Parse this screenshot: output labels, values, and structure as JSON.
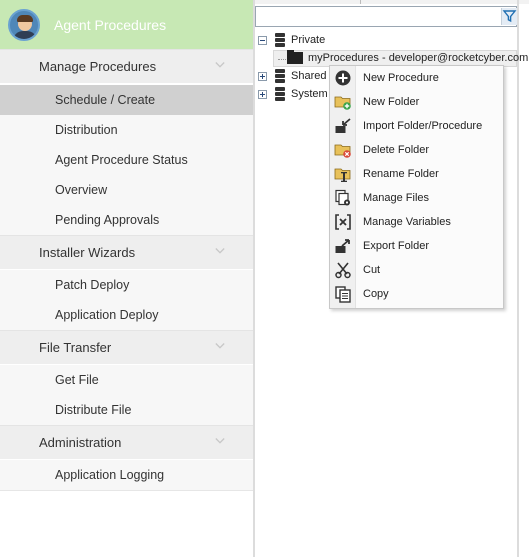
{
  "nav": {
    "title": "Agent Procedures",
    "sections": [
      {
        "label": "Manage Procedures",
        "items": [
          "Schedule / Create",
          "Distribution",
          "Agent Procedure Status",
          "Overview",
          "Pending Approvals"
        ]
      },
      {
        "label": "Installer Wizards",
        "items": [
          "Patch Deploy",
          "Application Deploy"
        ]
      },
      {
        "label": "File Transfer",
        "items": [
          "Get File",
          "Distribute File"
        ]
      },
      {
        "label": "Administration",
        "items": [
          "Application Logging"
        ]
      }
    ],
    "active_item": "Schedule / Create"
  },
  "tree": {
    "nodes": [
      {
        "label": "Private",
        "expander": "minus",
        "icon": "cabinet-icon"
      },
      {
        "label": "myProcedures - developer@rocketcyber.com",
        "icon": "folder-icon"
      },
      {
        "label": "Shared",
        "expander": "plus",
        "icon": "cabinet-icon"
      },
      {
        "label": "System",
        "expander": "plus",
        "icon": "cabinet-icon"
      }
    ]
  },
  "context_menu": {
    "items": [
      {
        "label": "New Procedure",
        "icon": "plus-circle-icon"
      },
      {
        "label": "New Folder",
        "icon": "new-folder-icon"
      },
      {
        "label": "Import Folder/Procedure",
        "icon": "import-icon"
      },
      {
        "label": "Delete Folder",
        "icon": "delete-folder-icon"
      },
      {
        "label": "Rename Folder",
        "icon": "rename-folder-icon"
      },
      {
        "label": "Manage Files",
        "icon": "manage-files-icon"
      },
      {
        "label": "Manage Variables",
        "icon": "variables-icon"
      },
      {
        "label": "Export Folder",
        "icon": "export-icon"
      },
      {
        "label": "Cut",
        "icon": "scissors-icon"
      },
      {
        "label": "Copy",
        "icon": "copy-icon"
      }
    ]
  },
  "colors": {
    "header_bg": "#c7e8b4",
    "active_item_bg": "#d0d0d0",
    "filter_icon": "#1f6fb2"
  }
}
